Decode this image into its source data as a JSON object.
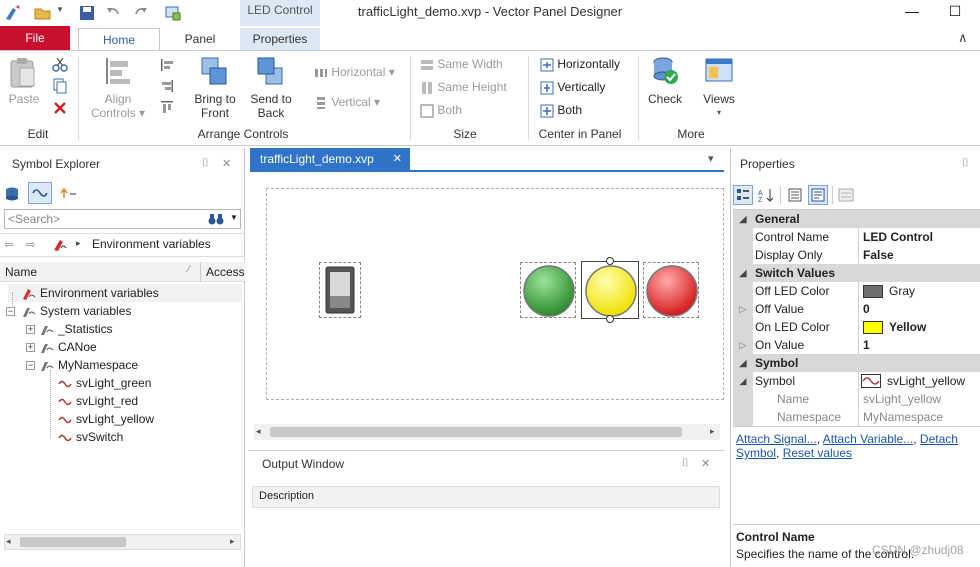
{
  "window": {
    "context_tab_header": "LED Control",
    "title": "trafficLight_demo.xvp - Vector Panel Designer",
    "min": "—",
    "max": "☐",
    "close": "✕"
  },
  "tabs": {
    "file": "File",
    "home": "Home",
    "panel": "Panel",
    "properties": "Properties",
    "collapse": "∧"
  },
  "ribbon": {
    "paste": "Paste",
    "align": [
      "Align",
      "Controls"
    ],
    "bring": [
      "Bring to",
      "Front"
    ],
    "send": [
      "Send to",
      "Back"
    ],
    "horizontal": "Horizontal",
    "vertical": "Vertical",
    "same_width": "Same Width",
    "same_height": "Same Height",
    "both": "Both",
    "center_h": "Horizontally",
    "center_v": "Vertically",
    "center_both": "Both",
    "check": "Check",
    "views": "Views",
    "groups": {
      "edit": "Edit",
      "arrange": "Arrange Controls",
      "size": "Size",
      "center": "Center in Panel",
      "more": "More"
    }
  },
  "explorer": {
    "title": "Symbol Explorer",
    "pin": "⌷",
    "close": "✕",
    "search_placeholder": "<Search>",
    "breadcrumb": "Environment variables",
    "col_name": "Name",
    "col_access": "Access",
    "tree": [
      "Environment variables",
      "System variables",
      "_Statistics",
      "CANoe",
      "MyNamespace",
      "svLight_green",
      "svLight_red",
      "svLight_yellow",
      "svSwitch"
    ]
  },
  "document": {
    "tab": "trafficLight_demo.xvp",
    "tab_close": "✕",
    "dropdown": "▾"
  },
  "output": {
    "title": "Output Window",
    "col": "Description",
    "pin": "⌷",
    "close": "✕"
  },
  "properties": {
    "title": "Properties",
    "pin": "⌷",
    "categories": {
      "general": "General",
      "switch": "Switch Values",
      "symbol": "Symbol"
    },
    "rows": {
      "control_name": {
        "name": "Control Name",
        "value": "LED Control"
      },
      "display_only": {
        "name": "Display Only",
        "value": "False"
      },
      "off_color": {
        "name": "Off LED Color",
        "value": "Gray",
        "swatch": "#6e6e6e"
      },
      "off_value": {
        "name": "Off Value",
        "value": "0"
      },
      "on_color": {
        "name": "On LED Color",
        "value": "Yellow",
        "swatch": "#ffff00"
      },
      "on_value": {
        "name": "On Value",
        "value": "1"
      },
      "symbol": {
        "name": "Symbol",
        "value": "svLight_yellow"
      },
      "sym_name": {
        "name": "Name",
        "value": "svLight_yellow"
      },
      "sym_ns": {
        "name": "Namespace",
        "value": "MyNamespace"
      }
    },
    "links": {
      "attach_signal": "Attach Signal...",
      "attach_variable": "Attach Variable...",
      "detach": "Detach",
      "symbol": "Symbol",
      "reset": "Reset values"
    },
    "desc_title": "Control Name",
    "desc_text": "Specifies the name of the control."
  },
  "watermark": "CSDN @zhudj08",
  "colors": {
    "file_tab": "#c8102e",
    "doc_tab": "#2f74c9",
    "accent_blue": "#2a5fa8",
    "led_green": "#3aa53a",
    "led_yellow": "#ffff33",
    "led_red": "#e02a2a"
  }
}
